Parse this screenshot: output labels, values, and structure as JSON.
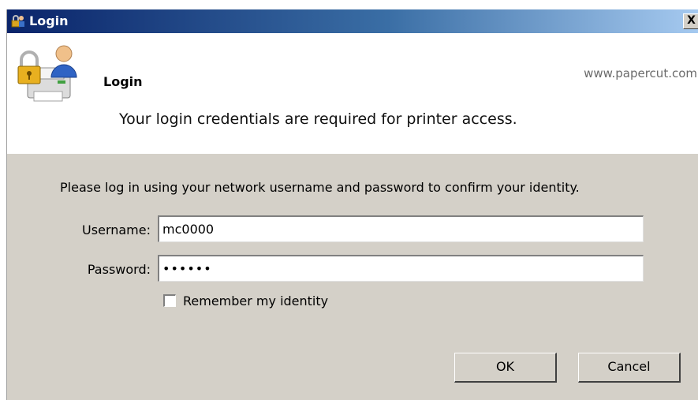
{
  "window": {
    "title": "Login",
    "close_label": "X"
  },
  "header": {
    "title": "Login",
    "url": "www.papercut.com",
    "description": "Your login credentials are required for printer access."
  },
  "form": {
    "instructions": "Please log in using your network username and password to confirm your identity.",
    "username_label": "Username:",
    "username_value": "mc0000",
    "password_label": "Password:",
    "password_value": "••••••",
    "remember_label": "Remember my identity",
    "remember_checked": false
  },
  "buttons": {
    "ok_label": "OK",
    "cancel_label": "Cancel"
  },
  "colors": {
    "titlebar_start": "#0a246a",
    "titlebar_end": "#a6caf0",
    "dialog_bg": "#d4d0c8"
  },
  "icons": {
    "title": "login-app-icon",
    "header": "printer-lock-user-icon"
  }
}
